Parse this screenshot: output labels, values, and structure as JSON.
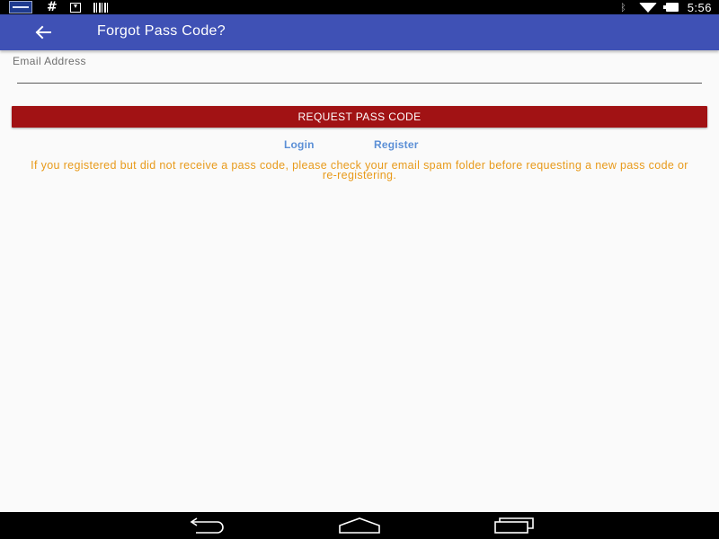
{
  "status_bar": {
    "time": "5:56",
    "left_icons": [
      "news-notification-icon",
      "hashtag-icon",
      "download-icon",
      "barcode-icon"
    ],
    "right_icons": [
      "bluetooth-icon",
      "wifi-icon",
      "battery-icon"
    ]
  },
  "app_bar": {
    "title": "Forgot Pass Code?",
    "back_icon": "back-arrow-icon",
    "color": "#3f51b5"
  },
  "form": {
    "email_label": "Email Address",
    "email_value": "",
    "email_placeholder": "",
    "request_button": "REQUEST PASS CODE",
    "request_button_color": "#a11214"
  },
  "links": {
    "login": "Login",
    "register": "Register",
    "color": "#5b8fd6"
  },
  "notice": {
    "text": "If you registered but did not receive a pass code, please check your email spam folder before requesting a new pass code or re-registering.",
    "color": "#e89a1a"
  },
  "nav_bar": {
    "buttons": [
      "back-icon",
      "home-icon",
      "recents-icon"
    ]
  }
}
